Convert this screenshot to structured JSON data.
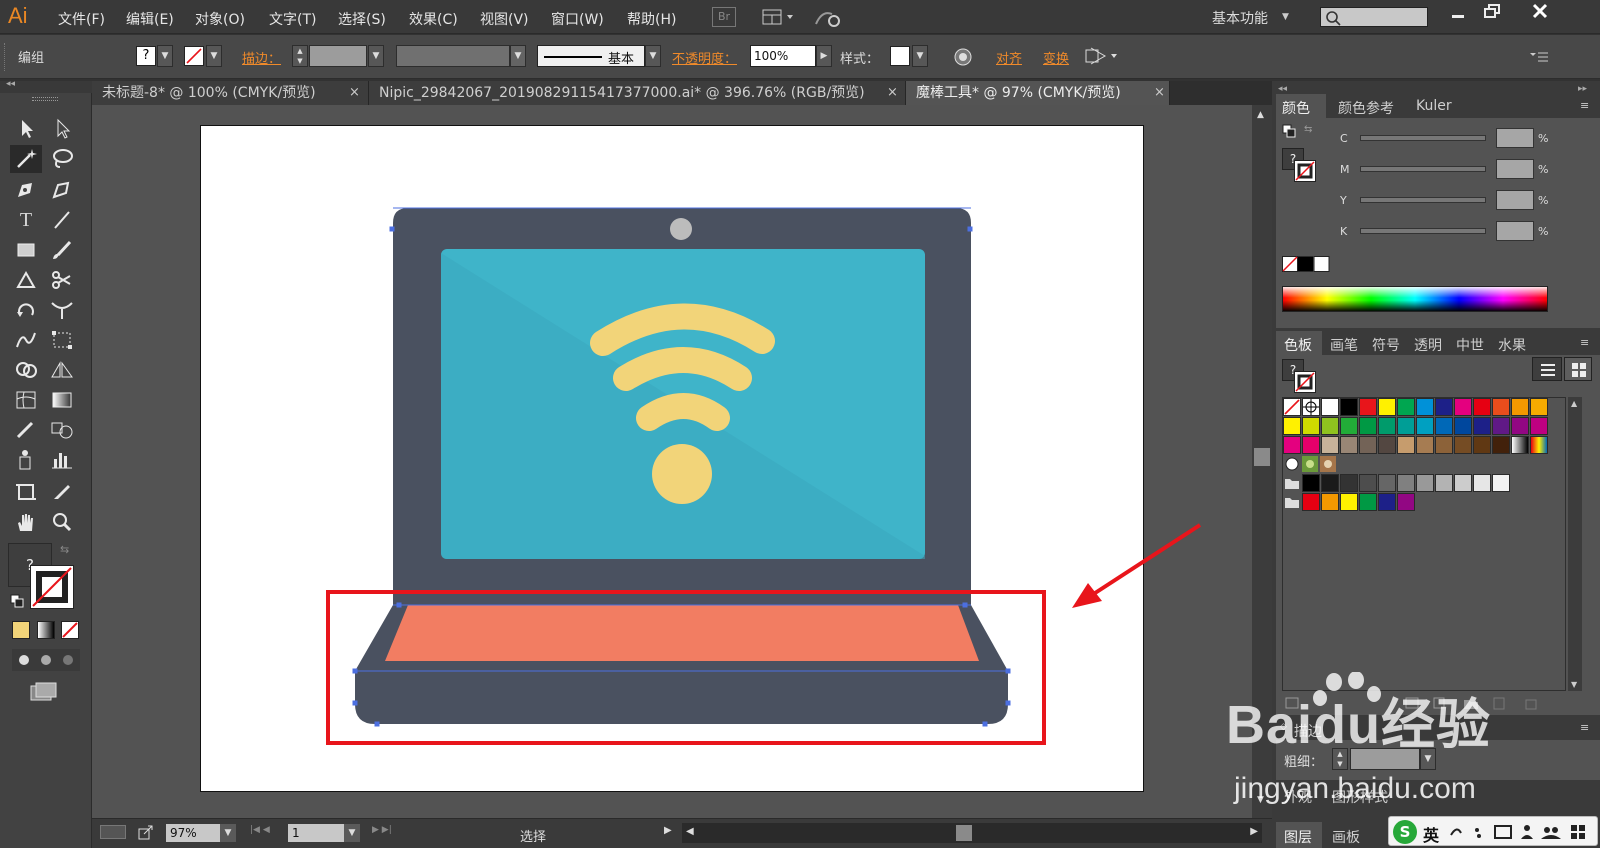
{
  "app": {
    "logo": "Ai",
    "workspace": "基本功能"
  },
  "menu": [
    "文件(F)",
    "编辑(E)",
    "对象(O)",
    "文字(T)",
    "选择(S)",
    "效果(C)",
    "视图(V)",
    "窗口(W)",
    "帮助(H)"
  ],
  "menu_extra": {
    "bridge": "Br"
  },
  "control": {
    "mode_label": "编组",
    "fill_q": "?",
    "stroke_label": "描边：",
    "stroke_style": "基本",
    "opacity_label": "不透明度：",
    "opacity_value": "100%",
    "style_label": "样式：",
    "align_label": "对齐",
    "transform_label": "变换"
  },
  "tabs": [
    {
      "label": "未标题-8* @ 100% (CMYK/预览)",
      "close": "×"
    },
    {
      "label": "Nipic_29842067_20190829115417377000.ai* @ 396.76% (RGB/预览)",
      "close": "×"
    },
    {
      "label": "魔棒工具* @ 97% (CMYK/预览)",
      "close": "×"
    }
  ],
  "toolbar": {
    "fill_q": "?"
  },
  "status": {
    "zoom": "97%",
    "page": "1",
    "mode": "选择"
  },
  "color_panel": {
    "tabs": [
      "颜色",
      "颜色参考",
      "Kuler"
    ],
    "q": "?",
    "channels": [
      {
        "name": "C",
        "unit": "%"
      },
      {
        "name": "M",
        "unit": "%"
      },
      {
        "name": "Y",
        "unit": "%"
      },
      {
        "name": "K",
        "unit": "%"
      }
    ]
  },
  "swatch_panel": {
    "tabs": [
      "色板",
      "画笔",
      "符号",
      "透明",
      "中世",
      "水果"
    ],
    "q": "?"
  },
  "stroke_panel": {
    "title": "描边",
    "weight_label": "粗细："
  },
  "appearance_panel": {
    "tabs": [
      "外观",
      "图形样式"
    ]
  },
  "layers_panel": {
    "tabs": [
      "图层",
      "画板"
    ]
  },
  "watermark": {
    "brand": "Baidu经验",
    "url": "jingyan.baidu.com"
  },
  "ime": {
    "label": "英"
  },
  "colors": {
    "laptop_body": "#4a5160",
    "screen": "#3fb4c9",
    "wifi": "#f2d479",
    "keyboard": "#f27d62",
    "camera": "#bcbcbc",
    "highlight": "#e8151b"
  },
  "swatches": {
    "row1": [
      "none",
      "reg",
      "#ffffff",
      "#000000",
      "#e8151b",
      "#fff100",
      "#00a650",
      "#0091d8",
      "#1d2088",
      "#e4007f",
      "#e60012",
      "#e94d1c",
      "#f39800",
      "#f6ab00"
    ],
    "row2": [
      "#fff100",
      "#cfdb00",
      "#8fc31f",
      "#22ac38",
      "#009944",
      "#009b6b",
      "#009e96",
      "#00a0c1",
      "#0068b7",
      "#00479d",
      "#1d2088",
      "#601986",
      "#920783",
      "#be0081"
    ],
    "row3": [
      "#e4007f",
      "#e5006a",
      "#c7b299",
      "#998675",
      "#736357",
      "#534741",
      "#c69c6d",
      "#a67c52",
      "#8c6239",
      "#754c24",
      "#603813",
      "#42210b",
      "#ffffff",
      "#ff0000"
    ],
    "row5": [
      "#000000",
      "#1a1a1a",
      "#333333",
      "#4d4d4d",
      "#666666",
      "#808080",
      "#999999",
      "#b3b3b3",
      "#cccccc",
      "#e6e6e6",
      "#f2f2f2"
    ],
    "row6": [
      "#e60012",
      "#f39800",
      "#fff100",
      "#009944",
      "#1d2088",
      "#920783"
    ]
  }
}
